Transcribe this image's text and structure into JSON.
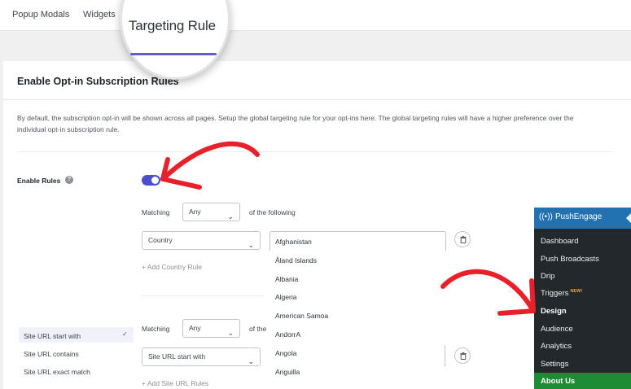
{
  "tabs": [
    {
      "label": "Popup Modals"
    },
    {
      "label": "Widgets"
    },
    {
      "label": "Targeting Rule",
      "active": true
    }
  ],
  "card": {
    "title": "Enable Opt-in Subscription Rules",
    "description": "By default, the subscription opt-in will be shown across all pages. Setup the global targeting rule for your opt-ins here. The global targeting rules will have a higher preference over the individual opt-in subscription rule.",
    "enable_rules_label": "Enable Rules",
    "enable_rules_on": true,
    "help_icon": "question-circle-icon"
  },
  "country_rule": {
    "matching_label": "Matching",
    "matching_value": "Any",
    "of_the_following": "of the following",
    "field_value": "Country",
    "add_link": "+ Add Country Rule",
    "country_options": [
      "Afghanistan",
      "Åland Islands",
      "Albania",
      "Algeria",
      "American Samoa",
      "AndorrA",
      "Angola",
      "Anguilla"
    ]
  },
  "url_rule": {
    "matching_label": "Matching",
    "matching_value": "Any",
    "of_the_truncated": "of the",
    "field_value": "Site URL start with",
    "add_link": "+ Add Site URL Rules",
    "options": [
      "Site URL start with",
      "Site URL contains",
      "Site URL exact match"
    ],
    "selected_option": "Site URL start with"
  },
  "wp_menu": {
    "title": "PushEngage",
    "items": [
      {
        "label": "Dashboard"
      },
      {
        "label": "Push Broadcasts"
      },
      {
        "label": "Drip"
      },
      {
        "label": "Triggers",
        "badge": "NEW!"
      },
      {
        "label": "Design",
        "current": true
      },
      {
        "label": "Audience"
      },
      {
        "label": "Analytics"
      },
      {
        "label": "Settings"
      }
    ],
    "about": "About Us"
  },
  "colors": {
    "accent": "#4a4fcf",
    "annotation_arrow": "#e8202a",
    "wp_menu_bg": "#23282d",
    "wp_head": "#2271b1",
    "about_bg": "#1d8c34"
  }
}
